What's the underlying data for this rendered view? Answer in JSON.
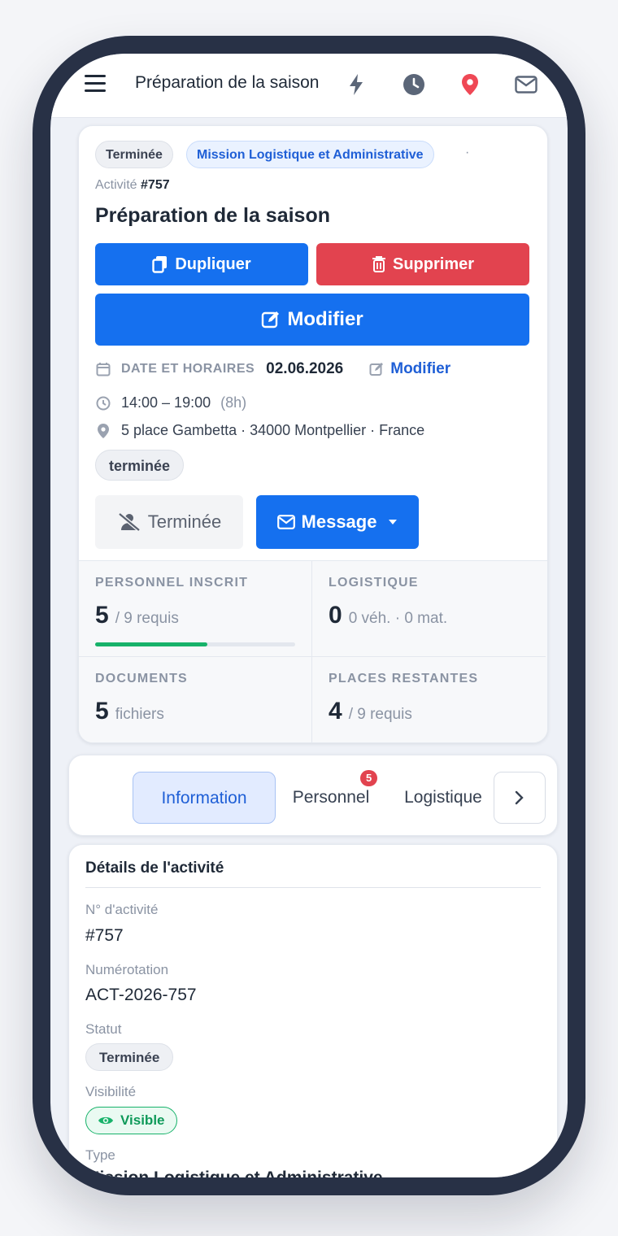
{
  "topbar": {
    "title": "Préparation de la saison",
    "icons": [
      "menu-icon",
      "bolt-icon",
      "clock-icon",
      "location-pin-icon",
      "envelope-icon"
    ]
  },
  "header": {
    "status_pill": "Terminée",
    "category_pill": "Mission Logistique et Administrative",
    "separator": "·",
    "activity_prefix": "Activité",
    "activity_number": "#757",
    "title": "Préparation de la saison"
  },
  "actions": {
    "duplicate": "Dupliquer",
    "delete": "Supprimer",
    "edit": "Modifier"
  },
  "schedule": {
    "label": "DATE ET HORAIRES",
    "date": "02.06.2026",
    "edit_link": "Modifier",
    "time_range": "14:00 – 19:00",
    "duration": "(8h)",
    "address": "5 place Gambetta · 34000 Montpellier · France",
    "state_pill": "terminée"
  },
  "participation": {
    "status_button": "Terminée",
    "message_button": "Message"
  },
  "stats": {
    "personnel": {
      "label": "PERSONNEL INSCRIT",
      "value": "5",
      "suffix": "/ 9 requis",
      "progress": 0.56
    },
    "logistics": {
      "label": "LOGISTIQUE",
      "value": "0",
      "suffix": "0 véh. · 0 mat."
    },
    "documents": {
      "label": "DOCUMENTS",
      "value": "5",
      "suffix": "fichiers"
    },
    "places": {
      "label": "PLACES RESTANTES",
      "value": "4",
      "suffix": "/ 9 requis"
    }
  },
  "tabs": {
    "items": [
      {
        "label": "Information",
        "active": true
      },
      {
        "label": "Personnel",
        "badge": "5"
      },
      {
        "label": "Logistique"
      }
    ]
  },
  "details": {
    "title": "Détails de l'activité",
    "activity_no_label": "N° d'activité",
    "activity_no": "#757",
    "numbering_label": "Numérotation",
    "numbering": "ACT-2026-757",
    "status_label": "Statut",
    "status": "Terminée",
    "visibility_label": "Visibilité",
    "visibility": "Visible",
    "type_label": "Type",
    "type": "Mission Logistique et Administrative"
  },
  "colors": {
    "primary": "#1570ef",
    "danger": "#e2434f",
    "success": "#17b26a",
    "text": "#1f2937"
  }
}
